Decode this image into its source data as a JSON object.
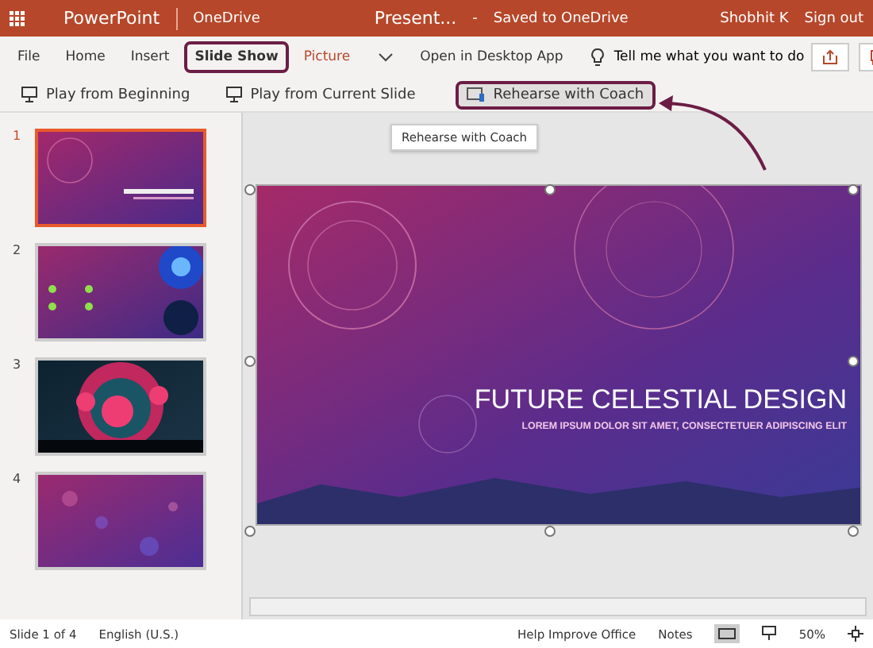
{
  "top_bar": {
    "app": "PowerPoint",
    "location": "OneDrive",
    "document": "Present...",
    "separator": "-",
    "save_status": "Saved to OneDrive",
    "user": "Shobhit K",
    "sign_out": "Sign out"
  },
  "ribbon_tabs": [
    {
      "label": "File",
      "selected": false,
      "kind": "tab"
    },
    {
      "label": "Home",
      "selected": false,
      "kind": "tab"
    },
    {
      "label": "Insert",
      "selected": false,
      "kind": "tab"
    },
    {
      "label": "Slide Show",
      "selected": true,
      "kind": "tab"
    },
    {
      "label": "Picture",
      "selected": false,
      "kind": "context"
    },
    {
      "label": "Open in Desktop App",
      "selected": false,
      "kind": "tab"
    }
  ],
  "tell_me": {
    "placeholder": "Tell me what you want to do"
  },
  "commands": [
    {
      "label": "Play from Beginning",
      "highlighted": false
    },
    {
      "label": "Play from Current Slide",
      "highlighted": false
    },
    {
      "label": "Rehearse with Coach",
      "highlighted": true
    }
  ],
  "tooltip": "Rehearse with Coach",
  "slides": [
    {
      "number": "1",
      "selected": true,
      "kind": "picture"
    },
    {
      "number": "2",
      "selected": false,
      "kind": "picture"
    },
    {
      "number": "3",
      "selected": false,
      "kind": "picture"
    },
    {
      "number": "4",
      "selected": false,
      "kind": "picture"
    }
  ],
  "current_slide": {
    "title": "FUTURE CELESTIAL DESIGN",
    "subtitle": "LOREM IPSUM DOLOR SIT AMET, CONSECTETUER ADIPISCING ELIT"
  },
  "status_bar": {
    "slide_info": "Slide 1 of 4",
    "language": "English (U.S.)",
    "help": "Help Improve Office",
    "notes": "Notes",
    "zoom": "50%"
  }
}
